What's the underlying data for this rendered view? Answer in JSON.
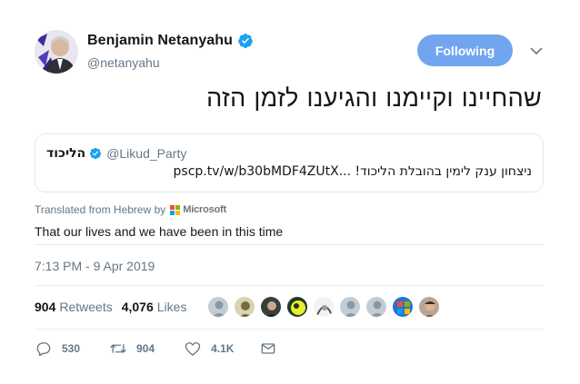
{
  "author": {
    "name": "Benjamin Netanyahu",
    "handle": "@netanyahu",
    "verified": true
  },
  "follow_button": {
    "label": "Following",
    "color": "#71a5ef"
  },
  "tweet_text": "שהחיינו וקיימנו והגיענו לזמן הזה",
  "quoted_tweet": {
    "name": "הליכוד",
    "handle": "@Likud_Party",
    "text": "ניצחון ענק לימין בהובלת הליכוד! ...pscp.tv/w/b30bMDF4ZUtX"
  },
  "translation": {
    "credit": "Translated from Hebrew by",
    "provider": "Microsoft",
    "text": "That our lives and we have been in this time"
  },
  "timestamp": "7:13 PM - 9 Apr 2019",
  "stats": {
    "retweets_count": "904",
    "retweets_label": "Retweets",
    "likes_count": "4,076",
    "likes_label": "Likes"
  },
  "liker_avatars": [
    "default",
    "photo-1",
    "photo-2",
    "photo-3",
    "photo-4",
    "default",
    "default",
    "windows-logo",
    "photo-5"
  ],
  "actions": {
    "replies": "530",
    "retweets": "904",
    "likes": "4.1K"
  },
  "colors": {
    "accent": "#1da1f2",
    "text_secondary": "#657786"
  }
}
